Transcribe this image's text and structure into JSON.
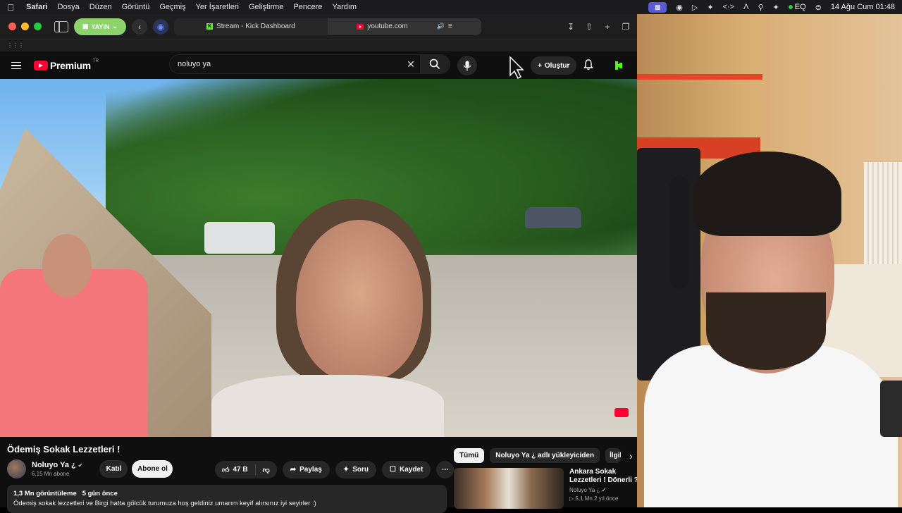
{
  "menubar": {
    "apple": "",
    "app": "Safari",
    "items": [
      "Dosya",
      "Düzen",
      "Görüntü",
      "Geçmiş",
      "Yer İşaretleri",
      "Geliştirme",
      "Pencere",
      "Yardım"
    ],
    "eq_label": "EQ",
    "datetime": "14 Ağu Cum  01:48"
  },
  "browser": {
    "yayin_label": "YAYIN",
    "tabs": [
      {
        "label": "Stream - Kick Dashboard",
        "icon": "kick-icon"
      },
      {
        "label": "youtube.com",
        "icon": "youtube-icon"
      }
    ]
  },
  "youtube": {
    "logo_word": "Premium",
    "logo_region": "TR",
    "search_value": "noluyo ya",
    "create_label": "Oluştur",
    "video": {
      "title": "Ödemiş Sokak Lezzetleri !",
      "channel_name": "Noluyo Ya ¿",
      "subscribers": "6,15 Mn abone",
      "join_label": "Katıl",
      "subscribe_label": "Abone ol",
      "likes": "47 B",
      "share_label": "Paylaş",
      "ask_label": "Soru",
      "save_label": "Kaydet",
      "views": "1,3 Mn görüntüleme",
      "age": "5 gün önce",
      "description": "Ödemiş sokak lezzetleri ve Birgi hatta gölcük turumuza hoş geldiniz umarım keyif alırsınız iyi seyirler :)"
    },
    "chips": [
      "Tümü",
      "Noluyo Ya ¿ adlı yükleyiciden",
      "İlgili"
    ],
    "recommendation": {
      "title": "Ankara Sokak Lezzetleri ! Dönerli ?",
      "channel": "Noluyo Ya ¿",
      "views": "5,1 Mn",
      "age": "2 yıl önce"
    }
  },
  "colors": {
    "yt_red": "#ff0033",
    "yayin_green": "#8dd36c",
    "kick_green": "#53fc18"
  }
}
